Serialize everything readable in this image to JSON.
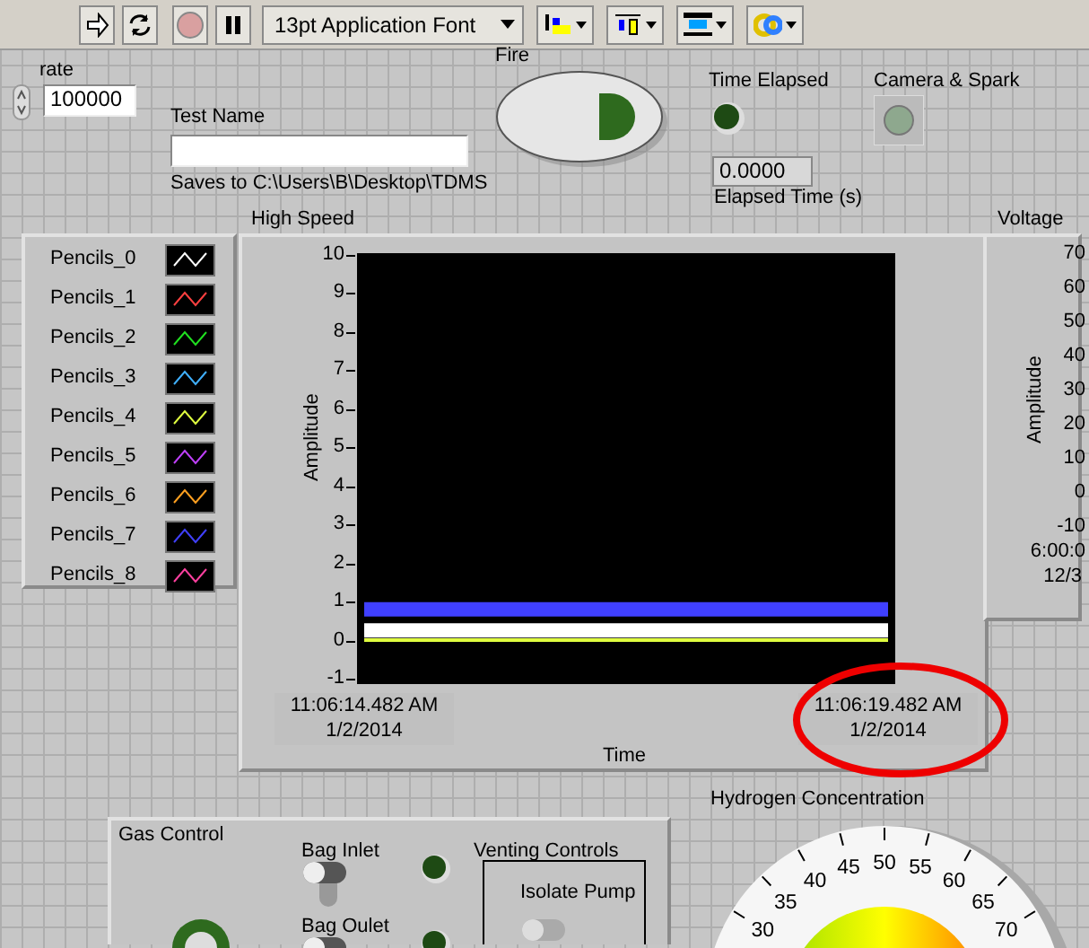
{
  "toolbar": {
    "font_label": "13pt Application Font"
  },
  "rate": {
    "label": "rate",
    "value": "100000"
  },
  "test_name": {
    "label": "Test Name",
    "note": "Saves to C:\\Users\\B\\Desktop\\TDMS"
  },
  "fire": {
    "label": "Fire"
  },
  "time_elapsed": {
    "label": "Time Elapsed",
    "on": false
  },
  "elapsed_time": {
    "value": "0.0000",
    "label": "Elapsed Time (s)"
  },
  "camera_spark": {
    "label": "Camera & Spark",
    "on": false
  },
  "legend": [
    {
      "name": "Pencils_0",
      "color": "#ffffff"
    },
    {
      "name": "Pencils_1",
      "color": "#ff4040"
    },
    {
      "name": "Pencils_2",
      "color": "#20e020"
    },
    {
      "name": "Pencils_3",
      "color": "#40b0ff"
    },
    {
      "name": "Pencils_4",
      "color": "#e0ff40"
    },
    {
      "name": "Pencils_5",
      "color": "#c040ff"
    },
    {
      "name": "Pencils_6",
      "color": "#ffa020"
    },
    {
      "name": "Pencils_7",
      "color": "#4040ff"
    },
    {
      "name": "Pencils_8",
      "color": "#ff40a0"
    }
  ],
  "high_speed": {
    "chart_data": {
      "type": "line",
      "title": "High Speed",
      "xlabel": "Time",
      "ylabel": "Amplitude",
      "ylim": [
        -1,
        10
      ],
      "yticks": [
        -1,
        0,
        1,
        2,
        3,
        4,
        5,
        6,
        7,
        8,
        9,
        10
      ],
      "categories": [
        "11:06:14.482 AM 1/2/2014",
        "11:06:19.482 AM 1/2/2014"
      ],
      "series": [
        {
          "color": "#4040ff",
          "values": [
            0.8,
            0.8
          ]
        },
        {
          "color": "#ffffff",
          "values": [
            0.25,
            0.25
          ]
        },
        {
          "color": "#e0ff40",
          "values": [
            0.0,
            0.0
          ]
        }
      ]
    }
  },
  "voltage": {
    "title": "Voltage",
    "ylabel": "Amplitude",
    "ytick_labels": [
      "70",
      "60",
      "50",
      "40",
      "30",
      "20",
      "10",
      "0",
      "-10"
    ],
    "xtick_label": [
      "6:00:0",
      "12/3"
    ]
  },
  "gas_control": {
    "title": "Gas Control",
    "valves": [
      {
        "label": "Bag Inlet",
        "on": false
      },
      {
        "label": "Bag Oulet",
        "on": false
      }
    ],
    "venting": {
      "title": "Venting Controls",
      "switch_label": "Isolate Pump",
      "on": false
    }
  },
  "hydrogen": {
    "title": "Hydrogen Concentration",
    "ticks": [
      "30",
      "35",
      "40",
      "45",
      "50",
      "55",
      "60",
      "65",
      "70"
    ]
  }
}
